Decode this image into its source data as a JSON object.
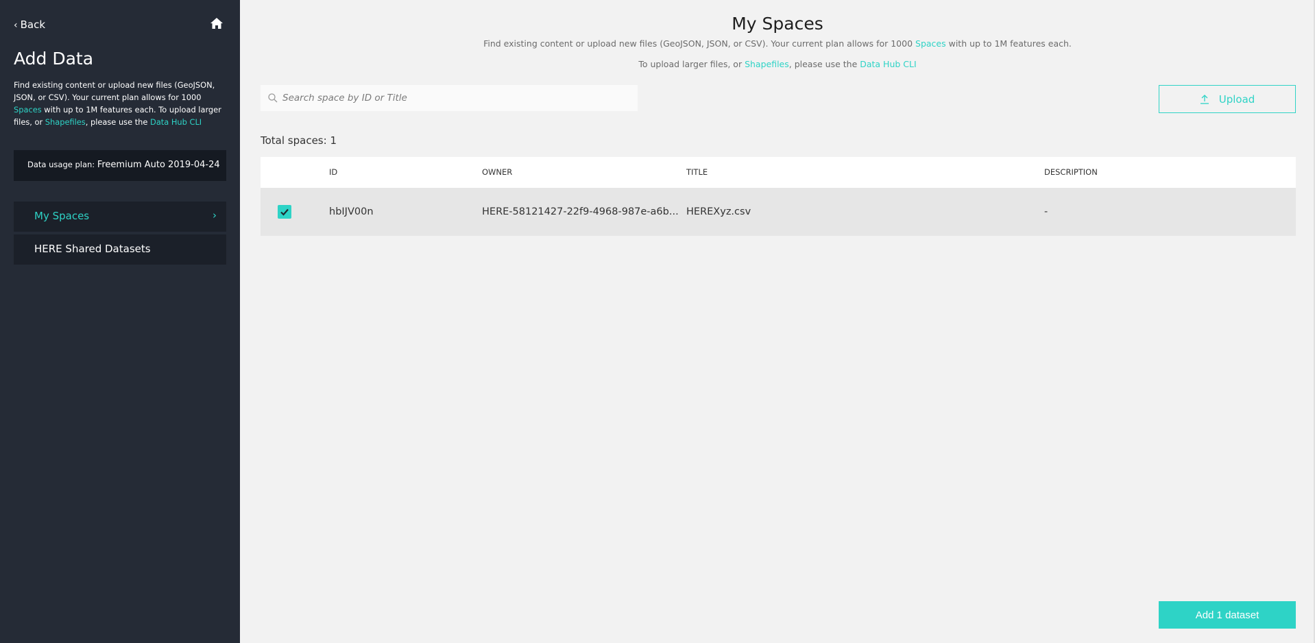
{
  "sidebar": {
    "back_label": "Back",
    "title": "Add Data",
    "desc_before_spaces": "Find existing content or upload new files (GeoJSON, JSON, or CSV). Your current plan allows for 1000 ",
    "spaces_link": "Spaces",
    "desc_mid": " with up to 1M features each. To upload larger files, or ",
    "shapefiles_link": "Shapefiles",
    "desc_after": ", please use the ",
    "cli_link": "Data Hub CLI",
    "plan_label": "Data usage plan:",
    "plan_value": "Freemium Auto 2019-04-24",
    "nav": [
      {
        "label": "My Spaces",
        "active": true
      },
      {
        "label": "HERE Shared Datasets",
        "active": false
      }
    ]
  },
  "main": {
    "title": "My Spaces",
    "sub1_before": "Find existing content or upload new files (GeoJSON, JSON, or CSV). Your current plan allows for 1000 ",
    "sub1_link": "Spaces",
    "sub1_after": " with up to 1M features each.",
    "sub2_before": "To upload larger files, or ",
    "sub2_link1": "Shapefiles",
    "sub2_mid": ", please use the ",
    "sub2_link2": "Data Hub CLI",
    "search_placeholder": "Search space by ID or Title",
    "upload_label": "Upload",
    "total_label": "Total spaces: 1",
    "columns": [
      "ID",
      "OWNER",
      "TITLE",
      "DESCRIPTION"
    ],
    "rows": [
      {
        "checked": true,
        "id": "hbIJV00n",
        "owner": "HERE-58121427-22f9-4968-987e-a6b...",
        "title": "HEREXyz.csv",
        "description": "-"
      }
    ],
    "add_label": "Add 1 dataset"
  },
  "icons": {
    "back": "chevron-left-icon",
    "home": "home-icon",
    "search": "search-icon",
    "upload": "upload-icon",
    "check": "check-icon",
    "nav_arrow": "chevron-right-icon"
  },
  "colors": {
    "accent": "#2ed3c6",
    "sidebar_bg": "#252b36",
    "main_bg": "#f2f2f2"
  }
}
